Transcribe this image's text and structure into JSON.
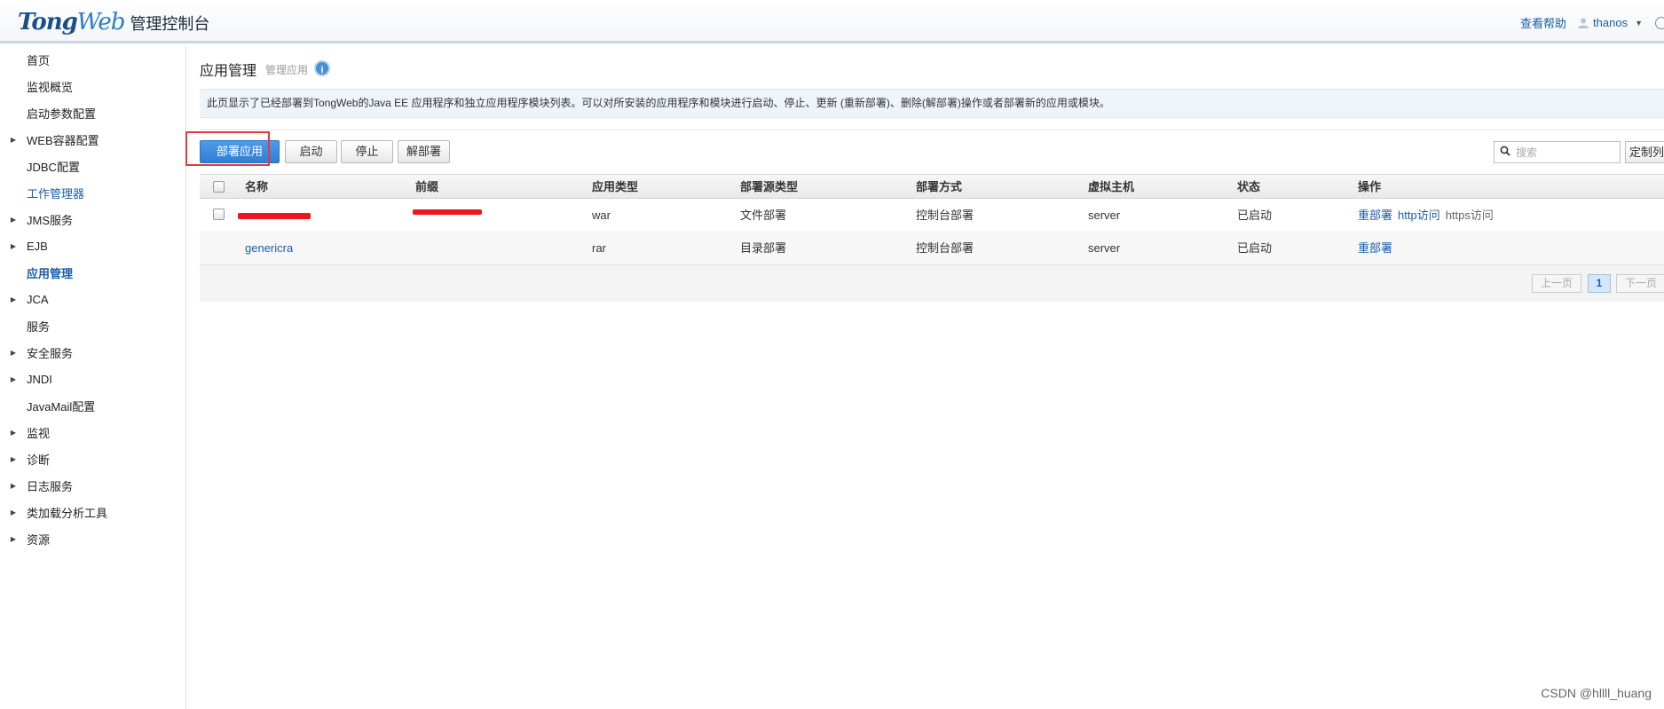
{
  "header": {
    "logo_tong": "Tong",
    "logo_web": "Web",
    "logo_cn": "管理控制台",
    "help_label": "查看帮助",
    "username": "thanos",
    "caret": "▼"
  },
  "sidebar": {
    "items": [
      {
        "label": "首页",
        "expandable": false
      },
      {
        "label": "监视概览",
        "expandable": false
      },
      {
        "label": "启动参数配置",
        "expandable": false
      },
      {
        "label": "WEB容器配置",
        "expandable": true
      },
      {
        "label": "JDBC配置",
        "expandable": false
      },
      {
        "label": "工作管理器",
        "expandable": false
      },
      {
        "label": "JMS服务",
        "expandable": true
      },
      {
        "label": "EJB",
        "expandable": true
      },
      {
        "label": "应用管理",
        "expandable": false
      },
      {
        "label": "JCA",
        "expandable": true
      },
      {
        "label": "服务",
        "expandable": false
      },
      {
        "label": "安全服务",
        "expandable": true
      },
      {
        "label": "JNDI",
        "expandable": true
      },
      {
        "label": "JavaMail配置",
        "expandable": false
      },
      {
        "label": "监视",
        "expandable": true
      },
      {
        "label": "诊断",
        "expandable": true
      },
      {
        "label": "日志服务",
        "expandable": true
      },
      {
        "label": "类加载分析工具",
        "expandable": true
      },
      {
        "label": "资源",
        "expandable": true
      }
    ]
  },
  "main": {
    "title": "应用管理",
    "subtitle": "管理应用",
    "info_glyph": "i",
    "description": "此页显示了已经部署到TongWeb的Java EE 应用程序和独立应用程序模块列表。可以对所安装的应用程序和模块进行启动、停止、更新 (重新部署)、删除(解部署)操作或者部署新的应用或模块。",
    "toolbar": {
      "deploy": "部署应用",
      "start": "启动",
      "stop": "停止",
      "undeploy": "解部署",
      "search_placeholder": "搜索",
      "customize": "定制列"
    },
    "table": {
      "headers": [
        "名称",
        "前缀",
        "应用类型",
        "部署源类型",
        "部署方式",
        "虚拟主机",
        "状态",
        "操作"
      ],
      "rows": [
        {
          "name": "",
          "prefix": "",
          "type": "war",
          "source": "文件部署",
          "mode": "控制台部署",
          "vhost": "server",
          "status": "已启动",
          "ops": [
            "重部署",
            "http访问",
            "https访问"
          ]
        },
        {
          "name": "genericra",
          "prefix": "",
          "type": "rar",
          "source": "目录部署",
          "mode": "控制台部署",
          "vhost": "server",
          "status": "已启动",
          "ops": [
            "重部署"
          ]
        }
      ]
    },
    "pager": {
      "prev": "上一页",
      "current": "1",
      "next": "下一页"
    }
  },
  "watermark": "CSDN @hllll_huang"
}
